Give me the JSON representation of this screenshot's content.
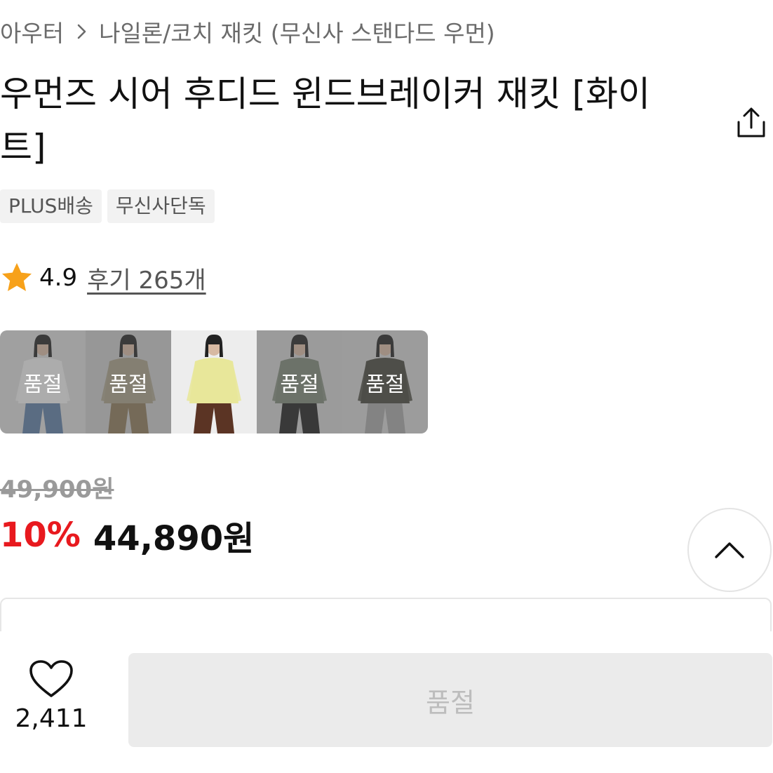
{
  "breadcrumb": {
    "category": "아우터",
    "subcategory": "나일론/코치 재킷 (무신사 스탠다드 우먼)"
  },
  "product": {
    "title": "우먼즈 시어 후디드 윈드브레이커 재킷 [화이트]"
  },
  "tags": [
    "PLUS배송",
    "무신사단독"
  ],
  "rating": {
    "score": "4.9",
    "reviews": "후기 265개",
    "star_color": "#f7a11a"
  },
  "color_options": [
    {
      "label": "품절",
      "sold_out": true,
      "bg": "#d9d9d9",
      "top": "#eeeeee",
      "bottom": "#5a7aa3"
    },
    {
      "label": "품절",
      "sold_out": true,
      "bg": "#c9c9c9",
      "top": "#a69d86",
      "bottom": "#8a7757"
    },
    {
      "label": "",
      "sold_out": false,
      "bg": "#ededed",
      "top": "#e8e79a",
      "bottom": "#5b3424"
    },
    {
      "label": "품절",
      "sold_out": true,
      "bg": "#cfcfcf",
      "top": "#7a8575",
      "bottom": "#1e1e1e"
    },
    {
      "label": "품절",
      "sold_out": true,
      "bg": "#d2d2d2",
      "top": "#44443b",
      "bottom": "#a5a5a5"
    }
  ],
  "price": {
    "original": "49,900원",
    "discount": "10%",
    "sale": "44,890원",
    "discount_color": "#e8191e"
  },
  "bottom_bar": {
    "like_count": "2,411",
    "purchase_label": "품절"
  },
  "icons": {
    "share": "share-icon",
    "breadcrumb_separator": "chevron-right-icon",
    "scroll_top": "chevron-up-icon",
    "like": "heart-icon",
    "star": "star-icon"
  }
}
